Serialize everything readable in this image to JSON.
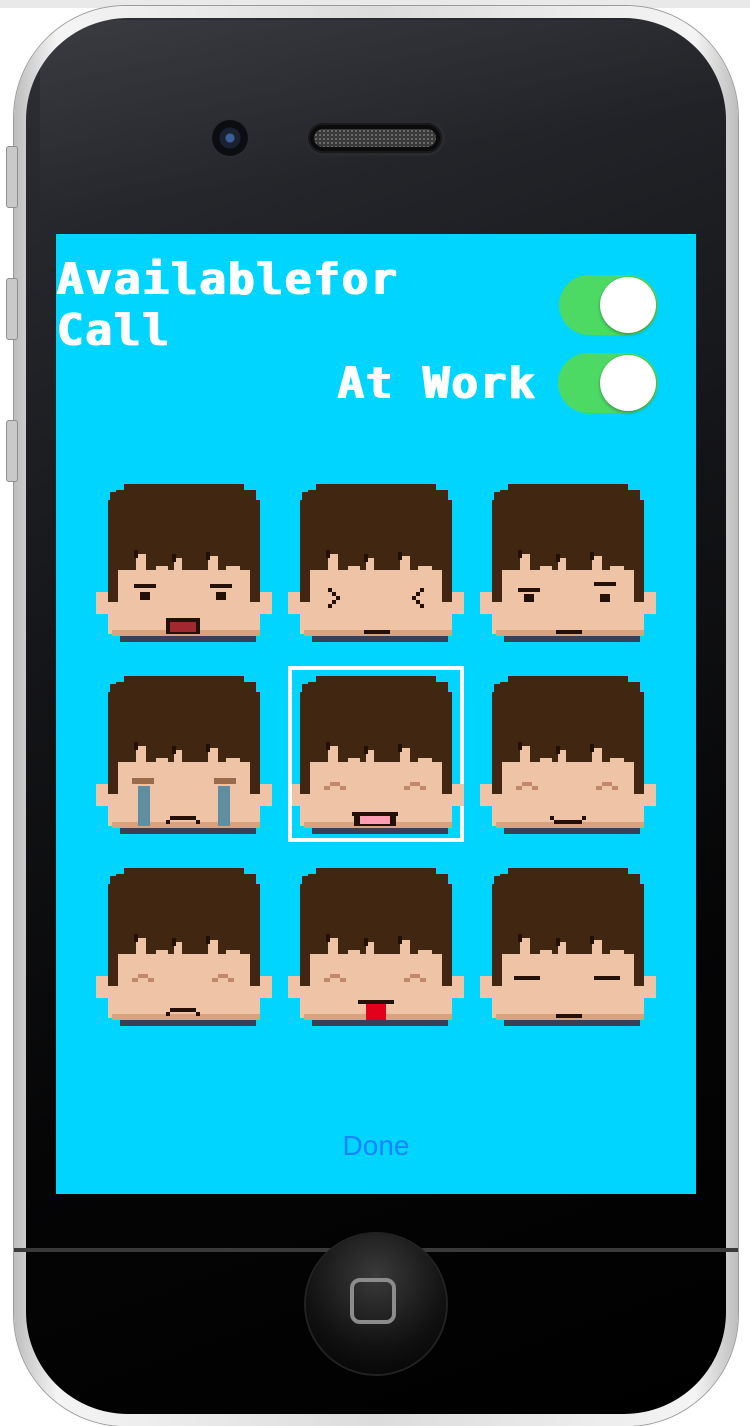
{
  "settings": {
    "available_label": "Availablefor Call",
    "available_on": true,
    "work_label": "At Work",
    "work_on": true
  },
  "faces": [
    {
      "expression": "shouting",
      "selected": false
    },
    {
      "expression": "squinting-x-eyes",
      "selected": false
    },
    {
      "expression": "skeptical",
      "selected": false
    },
    {
      "expression": "crying",
      "selected": false
    },
    {
      "expression": "laughing-open-mouth",
      "selected": true
    },
    {
      "expression": "smiling",
      "selected": false
    },
    {
      "expression": "sad",
      "selected": false
    },
    {
      "expression": "tongue-out",
      "selected": false
    },
    {
      "expression": "sleepy",
      "selected": false
    }
  ],
  "done_label": "Done",
  "colors": {
    "screen_bg": "#00d5ff",
    "toggle_on": "#4cd964",
    "hair": "#412612",
    "skin": "#efc4a6",
    "link": "#1a84ff"
  }
}
